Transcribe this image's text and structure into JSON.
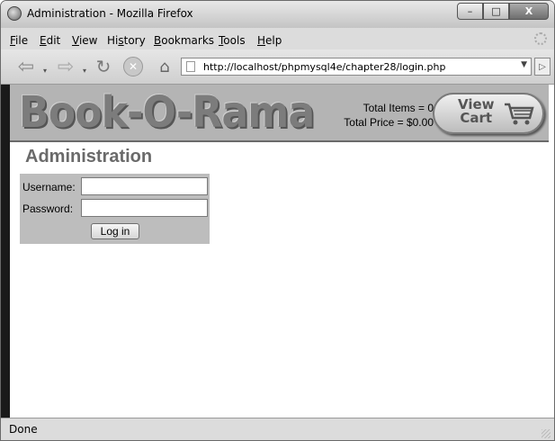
{
  "window": {
    "title": "Administration - Mozilla Firefox",
    "controls": {
      "minimize": "–",
      "maximize": "□",
      "close": "X"
    }
  },
  "menu": [
    {
      "accel": "F",
      "rest": "ile"
    },
    {
      "accel": "E",
      "rest": "dit"
    },
    {
      "accel": "V",
      "rest": "iew"
    },
    {
      "pre": "Hi",
      "accel": "s",
      "rest": "tory"
    },
    {
      "accel": "B",
      "rest": "ookmarks"
    },
    {
      "accel": "T",
      "rest": "ools"
    },
    {
      "accel": "H",
      "rest": "elp"
    }
  ],
  "nav": {
    "url": "http://localhost/phpmysql4e/chapter28/login.php"
  },
  "page": {
    "logo": "Book-O-Rama",
    "total_items": "Total Items = 0",
    "total_price": "Total Price = $0.00",
    "cart_line1": "View",
    "cart_line2": "Cart",
    "heading": "Administration",
    "form": {
      "username_label": "Username:",
      "password_label": "Password:",
      "username_value": "",
      "password_value": "",
      "submit_label": "Log in"
    }
  },
  "status": {
    "text": "Done"
  },
  "icons": [
    "firefox-icon",
    "back-icon",
    "forward-icon",
    "reload-icon",
    "stop-icon",
    "home-icon",
    "page-icon",
    "cart-icon",
    "throbber-icon"
  ]
}
